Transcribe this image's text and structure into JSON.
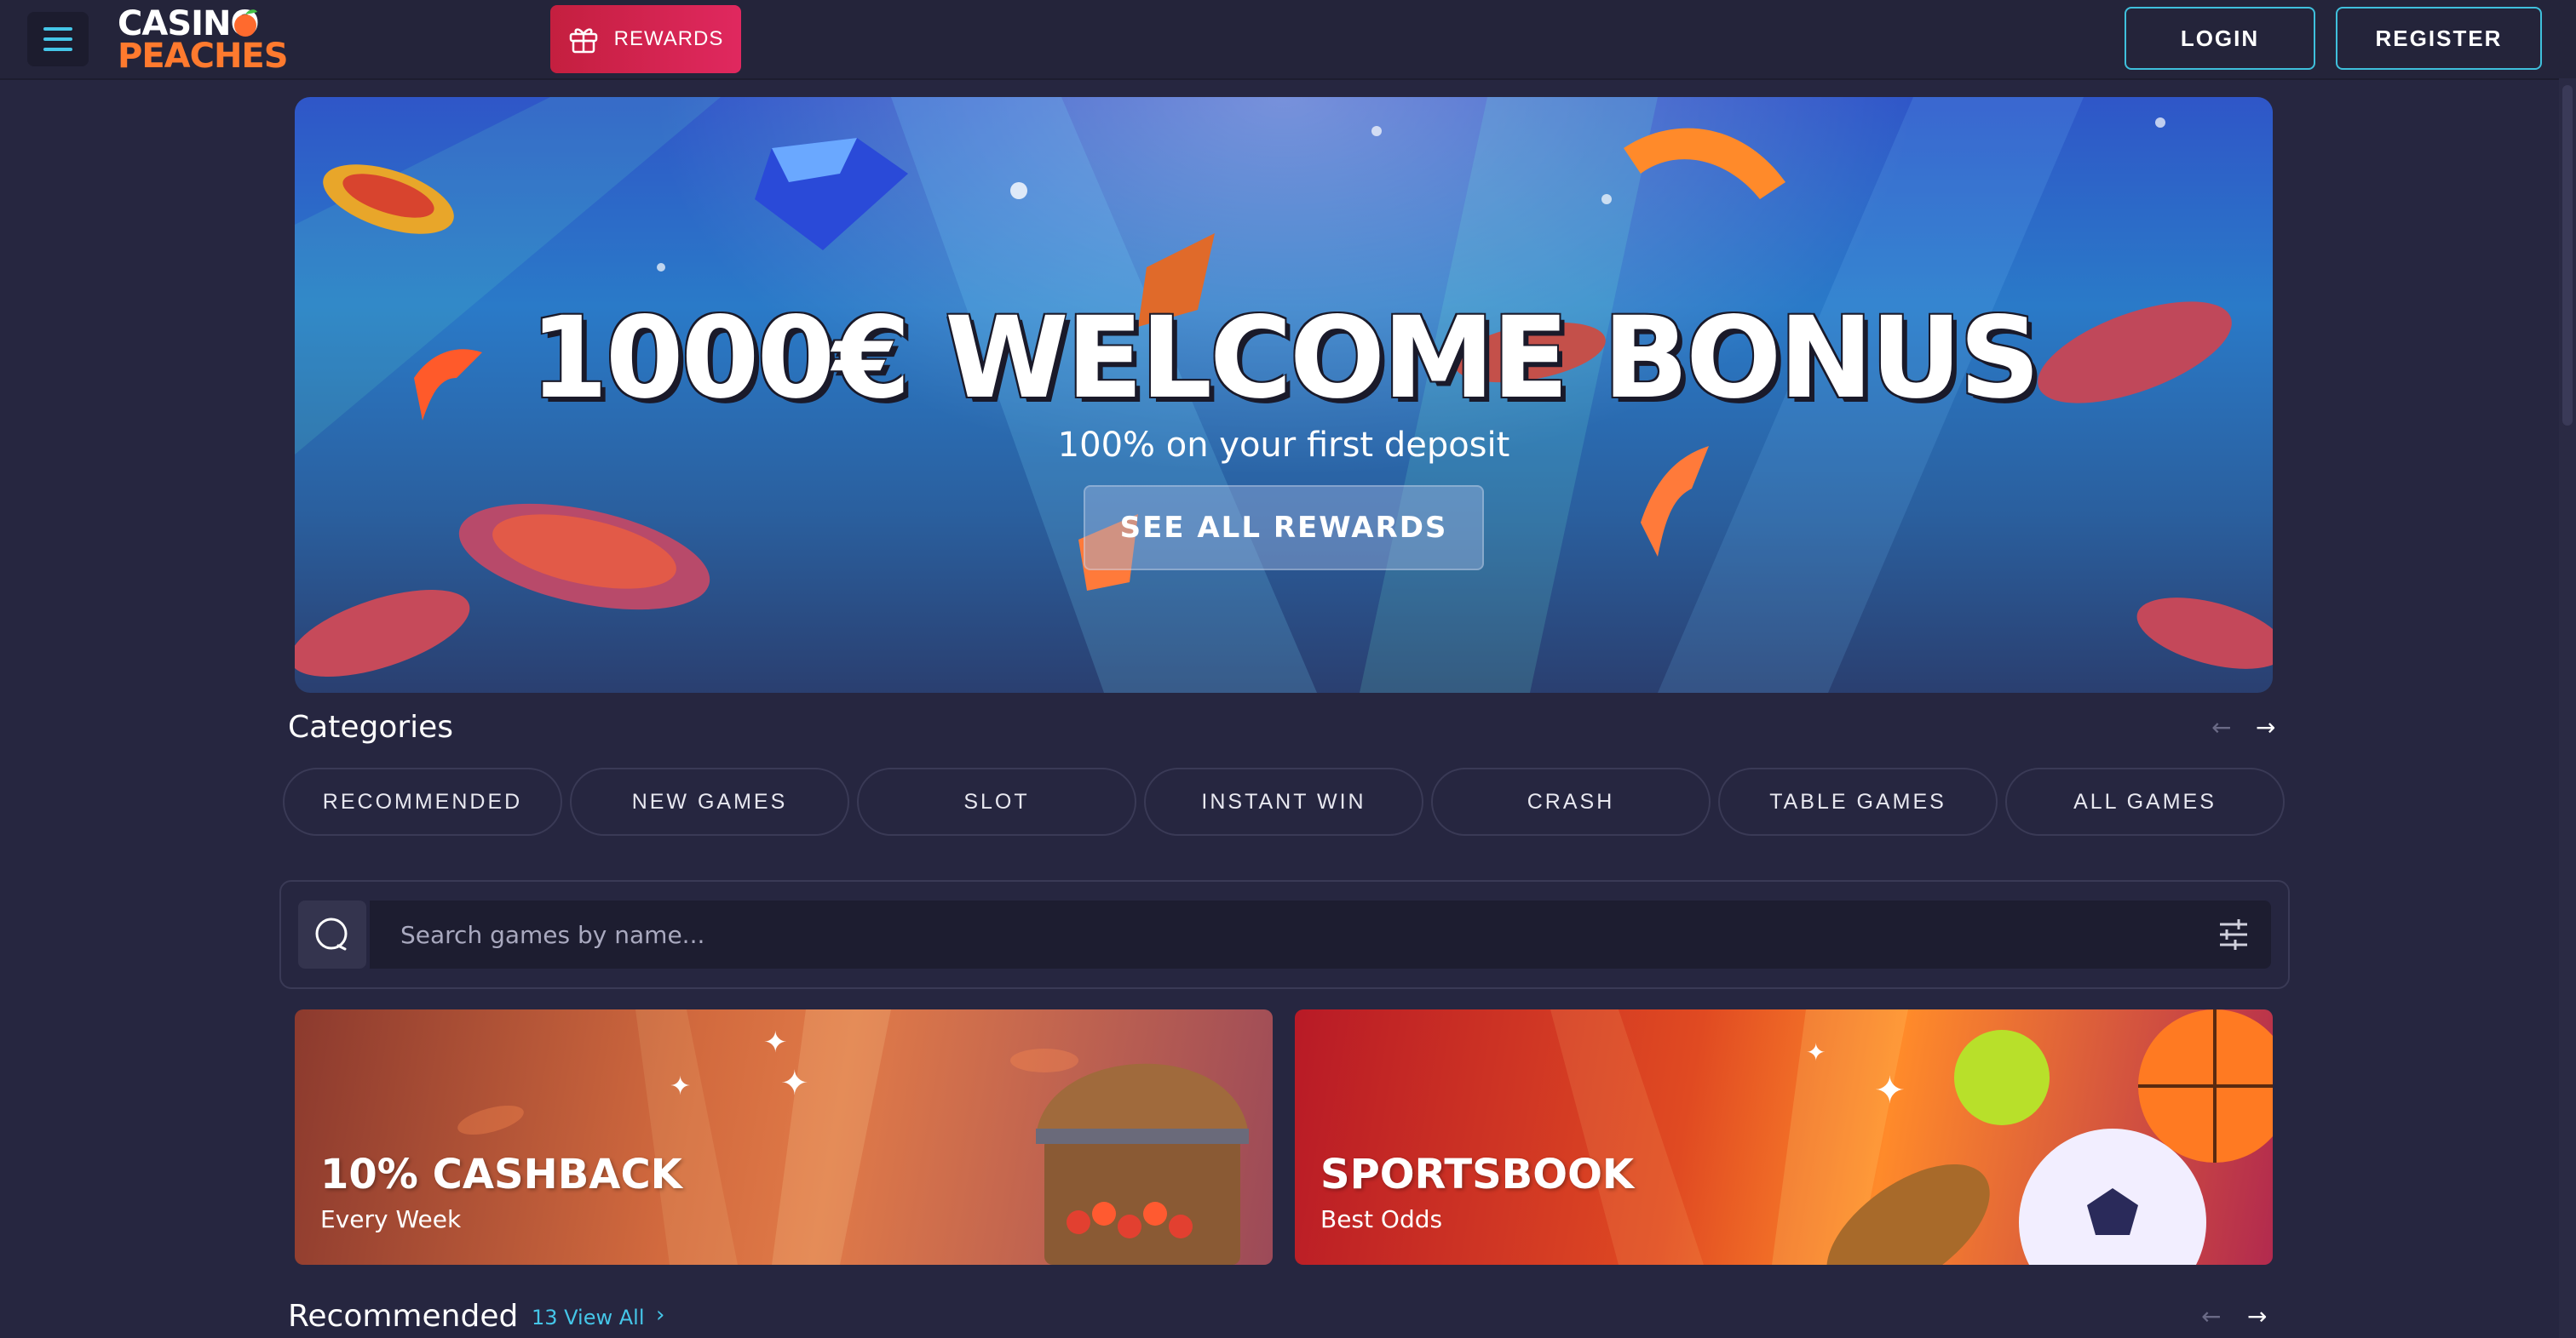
{
  "header": {
    "logo_line1": "CASINO",
    "logo_line2": "PEACHES",
    "rewards_label": "REWARDS",
    "login_label": "LOGIN",
    "register_label": "REGISTER",
    "icons": {
      "menu": "hamburger-menu-icon",
      "rewards": "gift-icon"
    }
  },
  "hero": {
    "title": "1000€ WELCOME BONUS",
    "subtitle": "100% on your first deposit",
    "cta_label": "SEE ALL REWARDS"
  },
  "categories": {
    "title": "Categories",
    "items": [
      "RECOMMENDED",
      "NEW GAMES",
      "SLOT",
      "INSTANT WIN",
      "CRASH",
      "TABLE GAMES",
      "ALL GAMES"
    ],
    "prev_arrow": "←",
    "next_arrow": "→"
  },
  "search": {
    "placeholder": "Search games by name...",
    "icons": {
      "search": "search-icon",
      "filter": "filter-sliders-icon"
    }
  },
  "promos": [
    {
      "title": "10% CASHBACK",
      "subtitle": "Every Week"
    },
    {
      "title": "SPORTSBOOK",
      "subtitle": "Best Odds"
    }
  ],
  "recommended": {
    "title": "Recommended",
    "count_label": "13 View All",
    "chevron": "›",
    "prev_arrow": "←",
    "next_arrow": "→"
  },
  "colors": {
    "background": "#262640",
    "accent_cyan": "#45c6e8",
    "rewards_red": "#d42450",
    "logo_orange": "#ff7a2e"
  }
}
